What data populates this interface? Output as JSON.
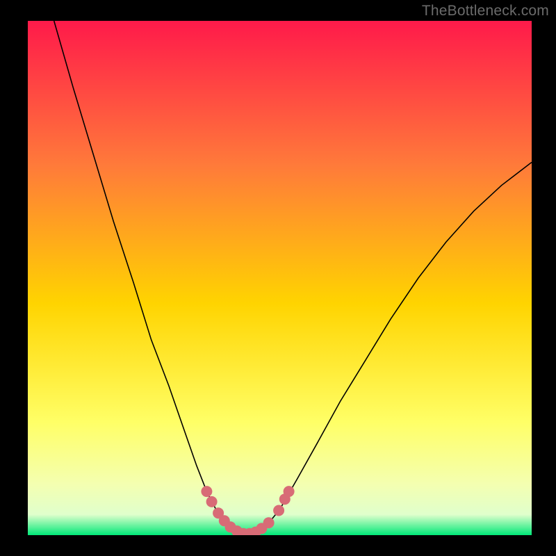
{
  "watermark": "TheBottleneck.com",
  "chart_data": {
    "type": "line",
    "title": "",
    "xlabel": "",
    "ylabel": "",
    "xlim": [
      0,
      1
    ],
    "ylim": [
      0,
      1
    ],
    "background_gradient": {
      "top": "#ff1a4a",
      "mid1": "#ff7a3a",
      "mid2": "#ffd400",
      "mid3": "#ffff66",
      "mid4": "#e0ffcc",
      "bottom": "#00e878"
    },
    "series": [
      {
        "name": "bottleneck-curve",
        "stroke": "#000000",
        "stroke_width": 1.6,
        "points": [
          {
            "x": 0.052,
            "y": 1.0
          },
          {
            "x": 0.09,
            "y": 0.87
          },
          {
            "x": 0.13,
            "y": 0.74
          },
          {
            "x": 0.17,
            "y": 0.61
          },
          {
            "x": 0.21,
            "y": 0.49
          },
          {
            "x": 0.245,
            "y": 0.38
          },
          {
            "x": 0.28,
            "y": 0.29
          },
          {
            "x": 0.31,
            "y": 0.205
          },
          {
            "x": 0.335,
            "y": 0.135
          },
          {
            "x": 0.355,
            "y": 0.085
          },
          {
            "x": 0.375,
            "y": 0.047
          },
          {
            "x": 0.395,
            "y": 0.022
          },
          {
            "x": 0.415,
            "y": 0.008
          },
          {
            "x": 0.435,
            "y": 0.002
          },
          {
            "x": 0.455,
            "y": 0.007
          },
          {
            "x": 0.475,
            "y": 0.02
          },
          {
            "x": 0.5,
            "y": 0.05
          },
          {
            "x": 0.535,
            "y": 0.11
          },
          {
            "x": 0.575,
            "y": 0.18
          },
          {
            "x": 0.62,
            "y": 0.26
          },
          {
            "x": 0.67,
            "y": 0.34
          },
          {
            "x": 0.72,
            "y": 0.42
          },
          {
            "x": 0.775,
            "y": 0.5
          },
          {
            "x": 0.83,
            "y": 0.57
          },
          {
            "x": 0.885,
            "y": 0.63
          },
          {
            "x": 0.94,
            "y": 0.68
          },
          {
            "x": 1.0,
            "y": 0.725
          }
        ]
      },
      {
        "name": "highlight-dots",
        "stroke": "#d86b76",
        "fill": "#d86b76",
        "radius": 8,
        "points": [
          {
            "x": 0.355,
            "y": 0.085
          },
          {
            "x": 0.365,
            "y": 0.065
          },
          {
            "x": 0.378,
            "y": 0.043
          },
          {
            "x": 0.39,
            "y": 0.028
          },
          {
            "x": 0.402,
            "y": 0.016
          },
          {
            "x": 0.415,
            "y": 0.008
          },
          {
            "x": 0.428,
            "y": 0.003
          },
          {
            "x": 0.44,
            "y": 0.003
          },
          {
            "x": 0.452,
            "y": 0.006
          },
          {
            "x": 0.464,
            "y": 0.013
          },
          {
            "x": 0.478,
            "y": 0.024
          },
          {
            "x": 0.498,
            "y": 0.048
          },
          {
            "x": 0.51,
            "y": 0.07
          },
          {
            "x": 0.518,
            "y": 0.085
          }
        ]
      }
    ]
  }
}
